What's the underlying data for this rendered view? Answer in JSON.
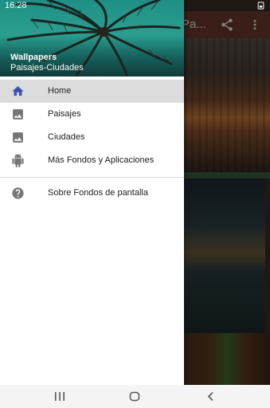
{
  "status_bar": {
    "time": "16:28"
  },
  "background_app": {
    "title": "Pa..."
  },
  "drawer": {
    "header_title": "Wallpapers",
    "header_subtitle": "Paisajes-Ciudades",
    "items": [
      {
        "label": "Home",
        "icon": "home-icon",
        "selected": true
      },
      {
        "label": "Paisajes",
        "icon": "image-icon"
      },
      {
        "label": "Ciudades",
        "icon": "image-icon"
      },
      {
        "label": "Más Fondos y Aplicaciones",
        "icon": "android-icon"
      },
      {
        "label": "Sobre Fondos de pantalla",
        "icon": "help-icon"
      }
    ]
  },
  "colors": {
    "accent": "#3f51b5",
    "icon_gray": "#757575",
    "selected_row": "#dcdcdc"
  }
}
